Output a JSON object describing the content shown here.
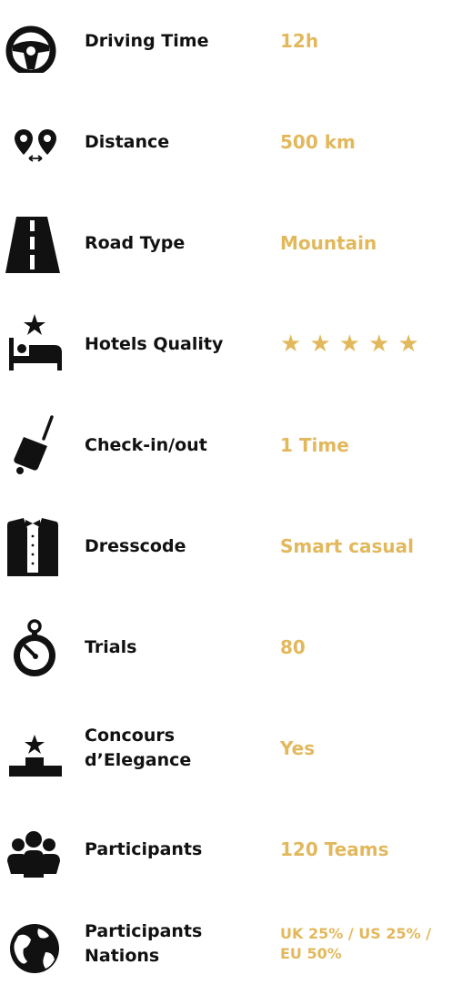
{
  "colors": {
    "accent": "#e2b85c",
    "text": "#111111"
  },
  "rows": [
    {
      "icon": "steering-wheel-icon",
      "label": "Driving Time",
      "value": "12h"
    },
    {
      "icon": "distance-pins-icon",
      "label": "Distance",
      "value": "500 km"
    },
    {
      "icon": "road-icon",
      "label": "Road Type",
      "value": "Mountain"
    },
    {
      "icon": "hotel-bed-icon",
      "label": "Hotels Quality",
      "value": "★ ★ ★ ★ ★",
      "rating": 5
    },
    {
      "icon": "luggage-icon",
      "label": "Check-in/out",
      "value": "1 Time"
    },
    {
      "icon": "tuxedo-icon",
      "label": "Dresscode",
      "value": "Smart casual"
    },
    {
      "icon": "stopwatch-icon",
      "label": "Trials",
      "value": "80"
    },
    {
      "icon": "podium-icon",
      "label": "Concours d’Elegance",
      "value": "Yes"
    },
    {
      "icon": "people-group-icon",
      "label": "Participants",
      "value": "120 Teams"
    },
    {
      "icon": "globe-icon",
      "label": "Participants Nations",
      "value": "UK 25% / US 25% / EU 50%"
    }
  ]
}
